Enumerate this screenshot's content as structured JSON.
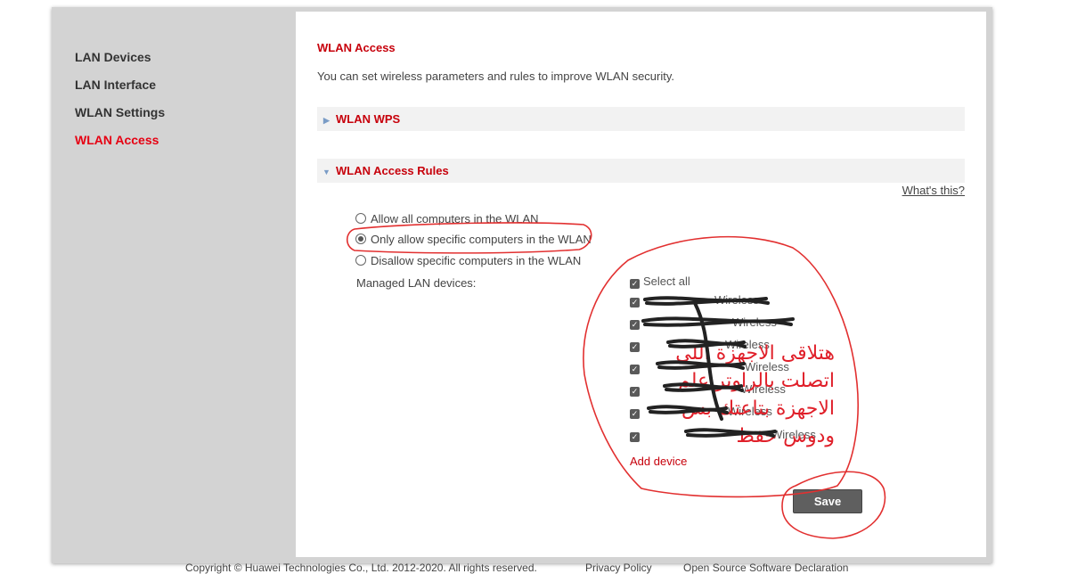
{
  "sidebar": {
    "items": [
      {
        "label": "LAN Devices"
      },
      {
        "label": "LAN Interface"
      },
      {
        "label": "WLAN Settings"
      },
      {
        "label": "WLAN Access"
      }
    ]
  },
  "main": {
    "title": "WLAN Access",
    "description": "You can set wireless parameters and rules to improve WLAN security.",
    "sections": {
      "wps": {
        "label": "WLAN WPS",
        "expanded": false
      },
      "rules": {
        "label": "WLAN Access Rules",
        "expanded": true
      }
    },
    "whats_this": "What's this?",
    "rule_options": [
      {
        "label": "Allow all computers in the WLAN",
        "selected": false
      },
      {
        "label": "Only allow specific computers in the WLAN",
        "selected": true
      },
      {
        "label": "Disallow specific computers in the WLAN",
        "selected": false
      }
    ],
    "managed_label": "Managed LAN devices:",
    "select_all": "Select all",
    "devices": [
      {
        "visible_text": "Wireless",
        "checked": true
      },
      {
        "visible_text": "Wireless",
        "checked": true
      },
      {
        "visible_text": "Wireless",
        "checked": true
      },
      {
        "visible_text": "Wireless",
        "checked": true
      },
      {
        "visible_text": "Wireless",
        "checked": true
      },
      {
        "visible_text": "Wireless",
        "checked": true
      },
      {
        "visible_text": "Wireless",
        "checked": true
      }
    ],
    "add_device": "Add device",
    "save": "Save"
  },
  "annotation": {
    "lines": [
      "هتلاقى الاجهزة اللى",
      "اتصلت بالراوتر  علم",
      "الاجهزة بتاعتك بس",
      "ودوس حفظ"
    ],
    "color": "#e0202a"
  },
  "footer": {
    "copyright": "Copyright © Huawei Technologies Co., Ltd. 2012-2020. All rights reserved.",
    "privacy": "Privacy Policy",
    "open_source": "Open Source Software Declaration"
  },
  "colors": {
    "accent": "#c7000b",
    "active_nav": "#e60012",
    "sidebar_bg": "#d3d3d3",
    "button_bg": "#5f5f5f"
  }
}
